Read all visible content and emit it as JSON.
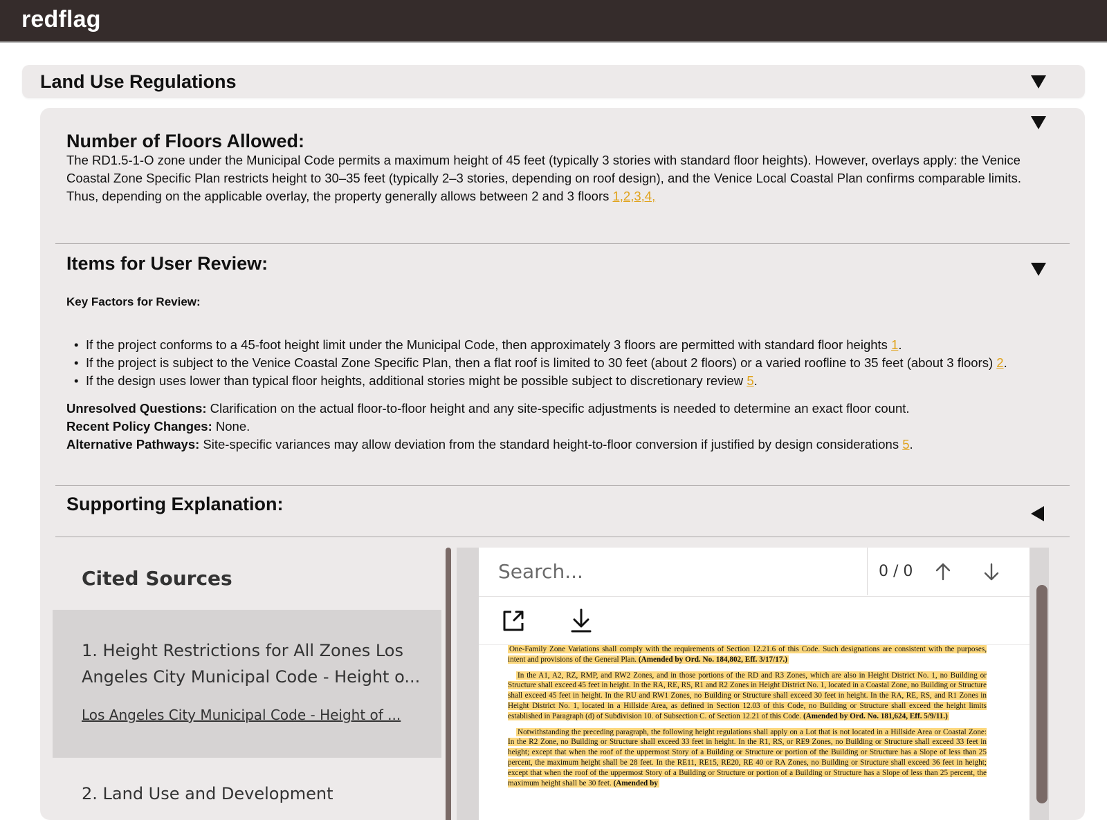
{
  "app": {
    "brand": "redflag"
  },
  "section": {
    "title": "Land Use Regulations"
  },
  "floors": {
    "heading": "Number of Floors Allowed:",
    "text_line1": "The RD1.5-1-O zone under the Municipal Code permits a maximum height of 45 feet (typically 3 stories with standard floor heights). However, overlays apply: the Venice",
    "text_line2": "Coastal Zone Specific Plan restricts height to 30–35 feet (typically 2–3 stories, depending on roof design), and the Venice Local Coastal Plan confirms comparable limits.",
    "text_line3": "Thus, depending on the applicable overlay, the property generally allows between 2 and 3 floors ",
    "citations": "1,2,3,4,"
  },
  "review": {
    "heading": "Items for User Review:",
    "key_factors_label": "Key Factors for Review:",
    "bullets": [
      {
        "text": "If the project conforms to a 45-foot height limit under the Municipal Code, then approximately 3 floors are permitted with standard floor heights ",
        "cite": "1",
        "end": "."
      },
      {
        "text": "If the project is subject to the Venice Coastal Zone Specific Plan, then a flat roof is limited to 30 feet (about 2 floors) or a varied roofline to 35 feet (about 3 floors) ",
        "cite": "2",
        "end": "."
      },
      {
        "text": "If the design uses lower than typical floor heights, additional stories might be possible subject to discretionary review ",
        "cite": "5",
        "end": "."
      }
    ],
    "unresolved_label": "Unresolved Questions:",
    "unresolved_text": " Clarification on the actual floor-to-floor height and any site-specific adjustments is needed to determine an exact floor count.",
    "policy_label": "Recent Policy Changes:",
    "policy_text": " None.",
    "alt_label": "Alternative Pathways:",
    "alt_text": " Site-specific variances may allow deviation from the standard height-to-floor conversion if justified by design considerations ",
    "alt_cite": "5",
    "alt_end": "."
  },
  "supporting": {
    "heading": "Supporting Explanation:"
  },
  "sources": {
    "title": "Cited Sources",
    "items": [
      {
        "name": "1. Height Restrictions for All Zones Los Angeles City Municipal Code - Height o...",
        "link": "Los Angeles City Municipal Code - Height of ..."
      },
      {
        "name": "2. Land Use and Development"
      }
    ]
  },
  "viewer": {
    "search_placeholder": "Search...",
    "counter": "0 / 0",
    "paragraphs": [
      {
        "text": "One-Family Zone Variations shall comply with the requirements of Section 12.21.6 of this Code. Such designations are consistent with the purposes, intent and provisions of the General Plan. ",
        "bold": "(Amended by Ord. No. 184,802, Eff. 3/17/17.)"
      },
      {
        "text": "In the A1, A2, RZ, RMP, and RW2 Zones, and in those portions of the RD and R3 Zones, which are also in Height District No. 1, no Building or Structure shall exceed 45 feet in height. In the RA, RE, RS, R1 and R2 Zones in Height District No. 1, located in a Coastal Zone, no Building or Structure shall exceed 45 feet in height. In the RU and RW1 Zones, no Building or Structure shall exceed 30 feet in height. In the RA, RE, RS, and R1 Zones in Height District No. 1, located in a Hillside Area, as defined in Section 12.03 of this Code, no Building or Structure shall exceed the height limits established in Paragraph (d) of Subdivision 10. of Subsection C. of Section 12.21 of this Code. ",
        "bold": "(Amended by Ord. No. 181,624, Eff. 5/9/11.)"
      },
      {
        "text": "Notwithstanding the preceding paragraph, the following height regulations shall apply on a Lot that is not located in a Hillside Area or Coastal Zone: In the R2 Zone, no Building or Structure shall exceed 33 feet in height. In the R1, RS, or RE9 Zones, no Building or Structure shall exceed 33 feet in height; except that when the roof of the uppermost Story of a Building or Structure or portion of the Building or Structure has a Slope of less than 25 percent, the maximum height shall be 28 feet. In the RE11, RE15, RE20, RE 40 or RA Zones, no Building or Structure shall exceed 36 feet in height; except that when the roof of the uppermost Story of a Building or Structure or portion of a Building or Structure has a Slope of less than 25 percent, the maximum height shall be 30 feet. ",
        "bold": "(Amended by"
      }
    ]
  },
  "colors": {
    "topbar": "#352c2b",
    "panel": "#edeaea",
    "citation": "#e0a21a",
    "highlight": "#fcd87e"
  }
}
